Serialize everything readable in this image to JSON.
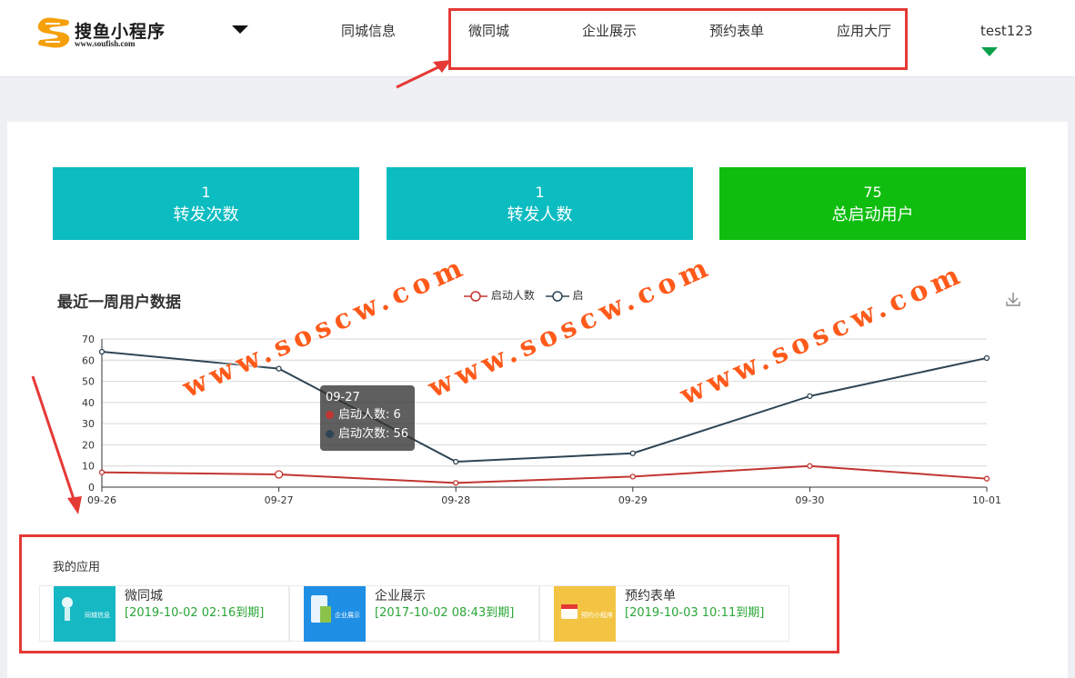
{
  "header": {
    "logo": {
      "brand": "搜鱼小程序",
      "url": "www.soufish.com"
    },
    "nav": [
      {
        "label": "同城信息"
      },
      {
        "label": "微同城"
      },
      {
        "label": "企业展示"
      },
      {
        "label": "预约表单"
      },
      {
        "label": "应用大厅"
      }
    ],
    "user": "test123"
  },
  "stats": [
    {
      "value": "1",
      "label": "转发次数",
      "color": "#0bbcc1"
    },
    {
      "value": "1",
      "label": "转发人数",
      "color": "#0bbcc1"
    },
    {
      "value": "75",
      "label": "总启动用户",
      "color": "#0ebd0e"
    }
  ],
  "chart": {
    "title": "最近一周用户数据",
    "legend": [
      "启动人数",
      "启"
    ],
    "tooltip": {
      "title": "09-27",
      "rows": [
        "启动人数: 6",
        "启动次数: 56"
      ]
    }
  },
  "chart_data": {
    "type": "line",
    "title": "最近一周用户数据",
    "x": [
      "09-26",
      "09-27",
      "09-28",
      "09-29",
      "09-30",
      "10-01"
    ],
    "series": [
      {
        "name": "启动人数",
        "values": [
          7,
          6,
          2,
          5,
          10,
          4
        ],
        "color": "#c23531"
      },
      {
        "name": "启动次数",
        "values": [
          64,
          56,
          12,
          16,
          43,
          61
        ],
        "color": "#2f4554"
      }
    ],
    "ylim": [
      0,
      70
    ],
    "yticks": [
      0,
      10,
      20,
      30,
      40,
      50,
      60,
      70
    ],
    "grid": true,
    "legend_position": "top-center"
  },
  "apps": {
    "title": "我的应用",
    "items": [
      {
        "name": "微同城",
        "expire": "[2019-10-02 02:16到期]",
        "thumb_text": "同城信息",
        "thumb_color": "#16b8c4"
      },
      {
        "name": "企业展示",
        "expire": "[2017-10-02 08:43到期]",
        "thumb_text": "企业展示",
        "thumb_color": "#1f8fe6"
      },
      {
        "name": "预约表单",
        "expire": "[2019-10-03 10:11到期]",
        "thumb_text": "预约小程序",
        "thumb_color": "#f3c443"
      }
    ]
  },
  "watermark": "www.soscw.com"
}
